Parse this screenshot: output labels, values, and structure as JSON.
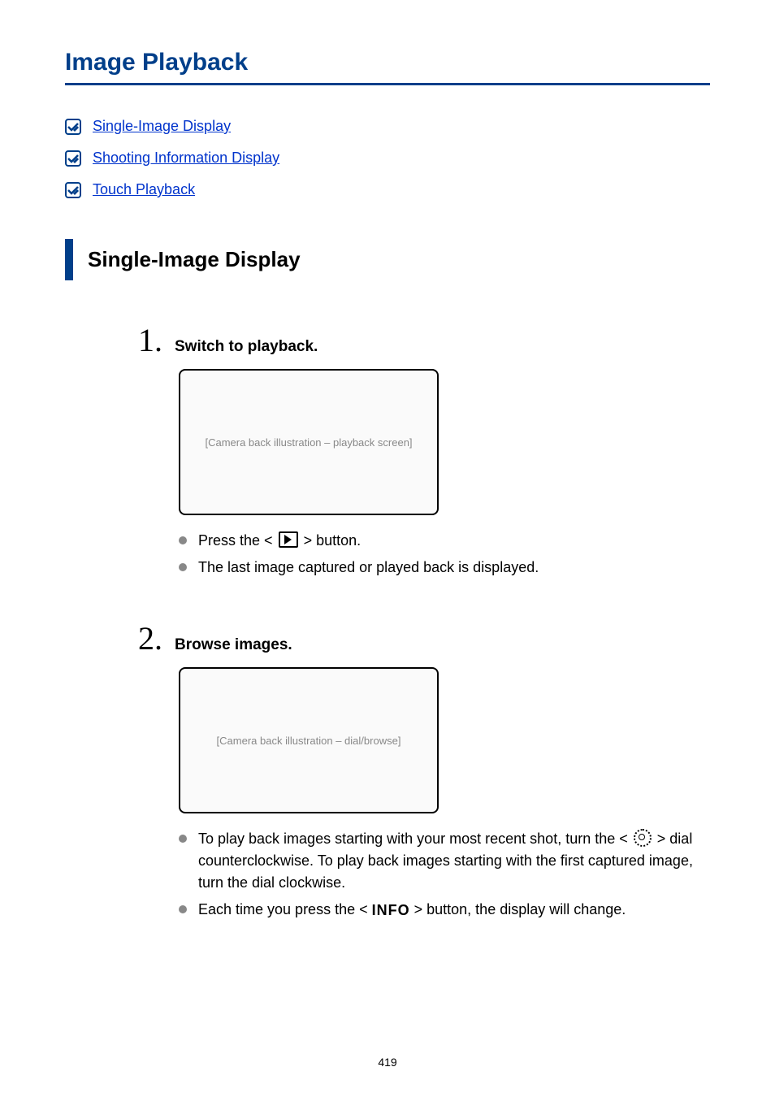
{
  "title": "Image Playback",
  "toc": [
    {
      "label": "Single-Image Display"
    },
    {
      "label": "Shooting Information Display"
    },
    {
      "label": "Touch Playback"
    }
  ],
  "section_heading": "Single-Image Display",
  "steps": [
    {
      "num": "1.",
      "title": "Switch to playback.",
      "illus_alt": "[Camera back illustration – playback screen]",
      "bullets": [
        {
          "pre": "Press the < ",
          "icon": "play-box",
          "post": " > button."
        },
        {
          "pre": "The last image captured or played back is displayed.",
          "icon": null,
          "post": ""
        }
      ]
    },
    {
      "num": "2.",
      "title": "Browse images.",
      "illus_alt": "[Camera back illustration – dial/browse]",
      "bullets": [
        {
          "pre": "To play back images starting with your most recent shot, turn the < ",
          "icon": "dial",
          "post": " > dial counterclockwise. To play back images starting with the first captured image, turn the dial clockwise."
        },
        {
          "pre": "Each time you press the < ",
          "icon": "info",
          "post": " > button, the display will change."
        }
      ]
    }
  ],
  "icon_info_label": "INFO",
  "page_number": "419"
}
